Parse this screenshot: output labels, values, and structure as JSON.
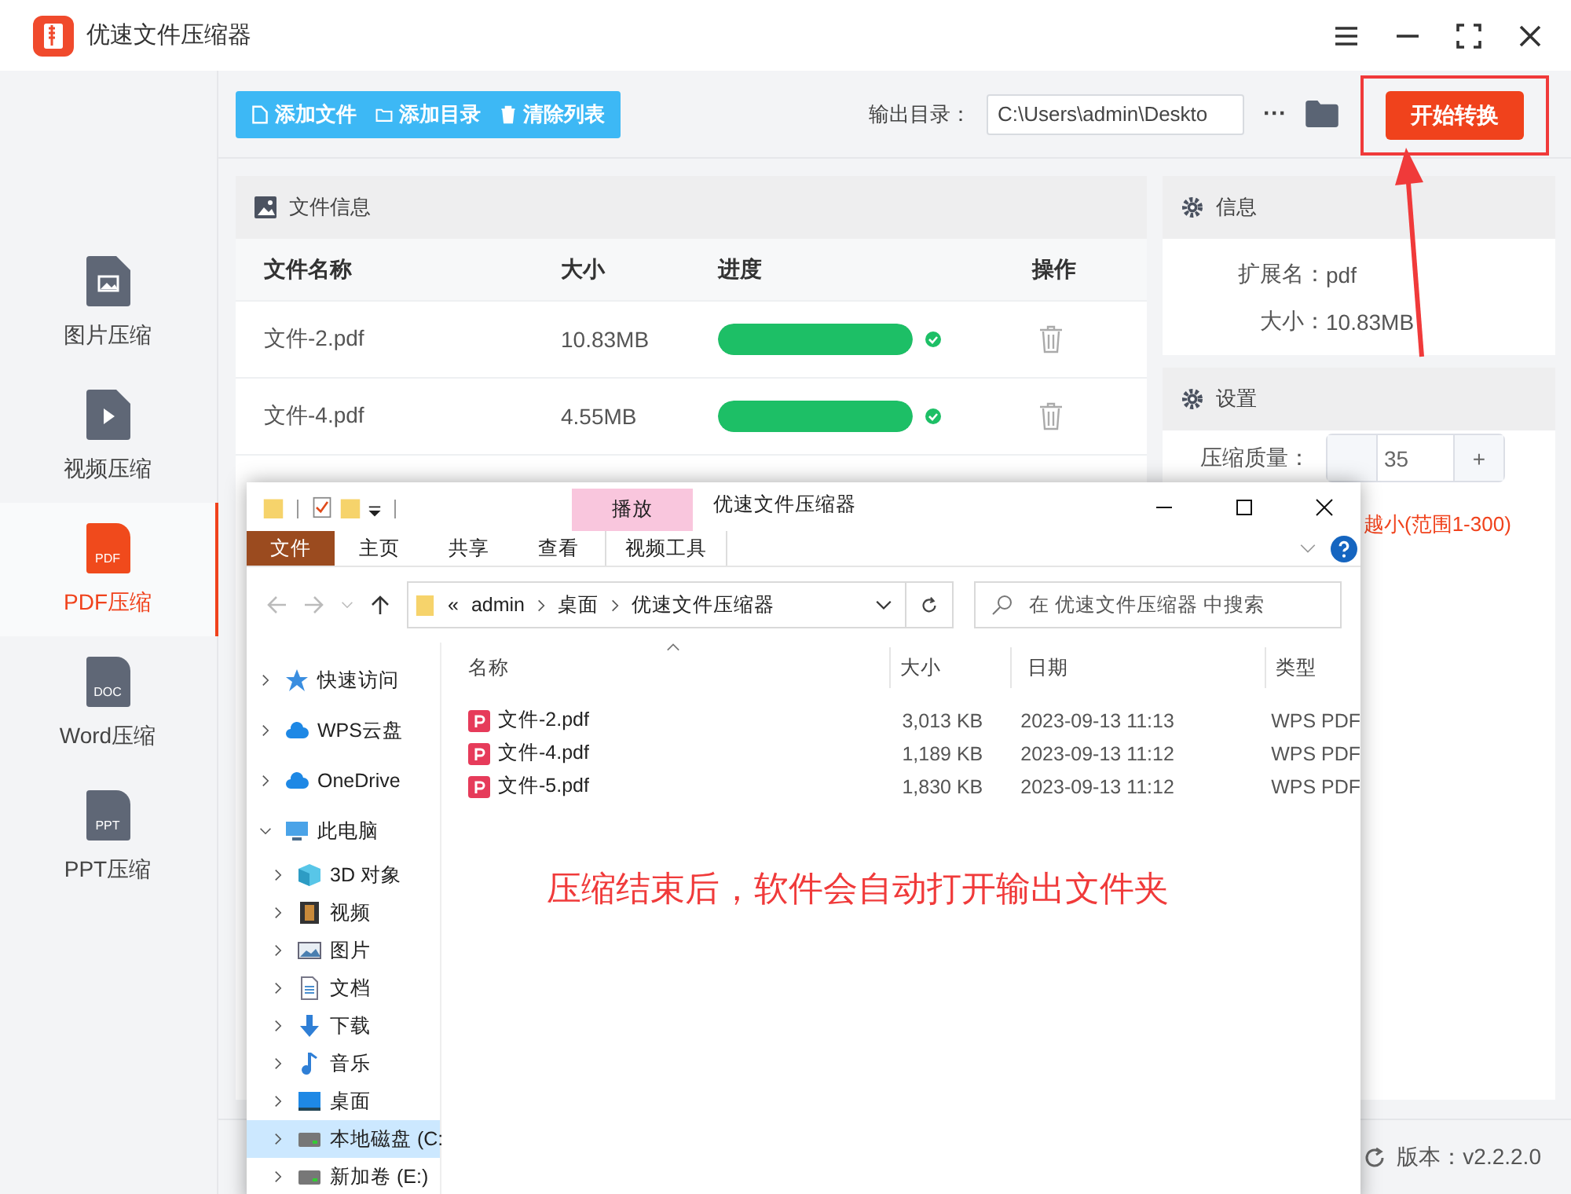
{
  "app": {
    "title": "优速文件压缩器"
  },
  "sidebar": {
    "items": [
      {
        "label": "图片压缩",
        "kind": "image",
        "selected": false
      },
      {
        "label": "视频压缩",
        "kind": "video",
        "selected": false
      },
      {
        "label": "PDF压缩",
        "kind": "doc",
        "badge": "PDF",
        "selected": true
      },
      {
        "label": "Word压缩",
        "kind": "doc",
        "badge": "DOC",
        "selected": false
      },
      {
        "label": "PPT压缩",
        "kind": "doc",
        "badge": "PPT",
        "selected": false
      }
    ]
  },
  "toolbar": {
    "buttons": [
      {
        "label": "添加文件",
        "kind": "file"
      },
      {
        "label": "添加目录",
        "kind": "folder"
      },
      {
        "label": "清除列表",
        "kind": "trash"
      }
    ],
    "output_label": "输出目录：",
    "output_path": "C:\\Users\\admin\\Deskto",
    "more": "···",
    "start_button": "开始转换"
  },
  "file_panel": {
    "title": "文件信息",
    "columns": [
      "文件名称",
      "大小",
      "进度",
      "操作"
    ],
    "rows": [
      {
        "name": "文件-2.pdf",
        "size": "10.83MB",
        "level": 1,
        "done": true
      },
      {
        "name": "文件-4.pdf",
        "size": "4.55MB",
        "level": 1,
        "done": true
      }
    ]
  },
  "info_panel": {
    "title": "信息",
    "fields": [
      {
        "label": "扩展名：",
        "value": "pdf"
      },
      {
        "label": "大小：",
        "value": "10.83MB"
      }
    ]
  },
  "settings_panel": {
    "title": "设置",
    "quality_label": "压缩质量：",
    "quality_value": "35",
    "plus": "+",
    "hint": "越小(范围1-300)"
  },
  "footer": {
    "version": "版本：v2.2.2.0"
  },
  "explorer": {
    "title": "优速文件压缩器",
    "context_tab": "播放",
    "ribbon_tabs": [
      {
        "label": "文件",
        "kind": "file"
      },
      {
        "label": "主页",
        "kind": "tab"
      },
      {
        "label": "共享",
        "kind": "tab"
      },
      {
        "label": "查看",
        "kind": "tab"
      },
      {
        "label": "视频工具",
        "kind": "context"
      }
    ],
    "address": {
      "prefix": "«",
      "crumbs": [
        "admin",
        "桌面",
        "优速文件压缩器"
      ]
    },
    "search": {
      "placeholder": "在 优速文件压缩器 中搜索"
    },
    "nav": [
      {
        "label": "快速访问",
        "kind": "star",
        "expanded": false,
        "selected": false
      },
      {
        "label": "WPS云盘",
        "kind": "cloud",
        "expanded": false,
        "selected": false
      },
      {
        "label": "OneDrive",
        "kind": "cloud",
        "expanded": false,
        "selected": false
      },
      {
        "label": "此电脑",
        "kind": "pc",
        "expanded": true,
        "selected": false,
        "children": [
          {
            "label": "3D 对象",
            "kind": "cube",
            "expanded": false,
            "selected": false
          },
          {
            "label": "视频",
            "kind": "film",
            "expanded": false,
            "selected": false
          },
          {
            "label": "图片",
            "kind": "photo",
            "expanded": false,
            "selected": false
          },
          {
            "label": "文档",
            "kind": "document",
            "expanded": false,
            "selected": false
          },
          {
            "label": "下载",
            "kind": "download",
            "expanded": false,
            "selected": false
          },
          {
            "label": "音乐",
            "kind": "music",
            "expanded": false,
            "selected": false
          },
          {
            "label": "桌面",
            "kind": "desktop",
            "expanded": false,
            "selected": false
          },
          {
            "label": "本地磁盘 (C:",
            "kind": "drive",
            "expanded": false,
            "selected": true
          },
          {
            "label": "新加卷 (E:)",
            "kind": "drive",
            "expanded": false,
            "selected": false
          }
        ]
      }
    ],
    "columns": [
      "名称",
      "大小",
      "日期",
      "类型"
    ],
    "files": [
      {
        "name": "文件-2.pdf",
        "size": "3,013 KB",
        "date": "2023-09-13 11:13",
        "type": "WPS PDF"
      },
      {
        "name": "文件-4.pdf",
        "size": "1,189 KB",
        "date": "2023-09-13 11:12",
        "type": "WPS PDF"
      },
      {
        "name": "文件-5.pdf",
        "size": "1,830 KB",
        "date": "2023-09-13 11:12",
        "type": "WPS PDF"
      }
    ],
    "note": "压缩结束后，软件会自动打开输出文件夹"
  }
}
